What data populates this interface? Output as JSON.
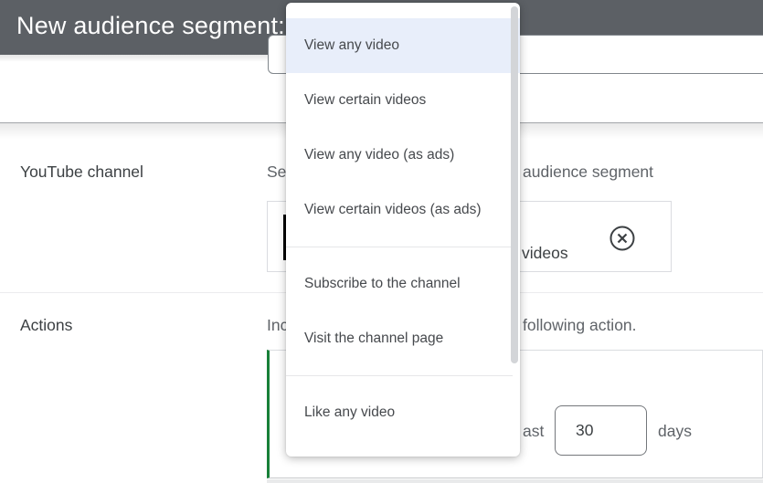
{
  "header": {
    "title": "New audience segment:"
  },
  "content": {
    "rows": [
      {
        "label": "YouTube channel",
        "description_fragment_left": "Sel",
        "description_fragment_right": "audience segment"
      },
      {
        "label": "Actions",
        "description_fragment_left": "Inc",
        "description_fragment_right": "following action."
      }
    ],
    "channel_card": {
      "visible_text": "videos",
      "remove_icon": "circle-x-icon",
      "thumbnail": "video-thumbnail-black"
    },
    "action_card": {
      "lookback_fragment_left": "ast",
      "lookback_days_value": "30",
      "lookback_suffix": "days"
    }
  },
  "dropdown": {
    "items": [
      {
        "label": "View any video",
        "selected": true
      },
      {
        "label": "View certain videos",
        "selected": false
      },
      {
        "label": "View any video (as ads)",
        "selected": false
      },
      {
        "label": "View certain videos (as ads)",
        "selected": false
      },
      {
        "divider": true
      },
      {
        "label": "Subscribe to the channel",
        "selected": false
      },
      {
        "label": "Visit the channel page",
        "selected": false
      },
      {
        "divider": true
      },
      {
        "label": "Like any video",
        "selected": false
      }
    ]
  },
  "colors": {
    "topbar_bg": "#5c6065",
    "accent_green": "#188038",
    "menu_highlight": "#e8eefa",
    "text_dark": "#3c4043",
    "text_gray": "#5f6368",
    "border_light": "#dadce0",
    "border_medium": "#80868b"
  }
}
